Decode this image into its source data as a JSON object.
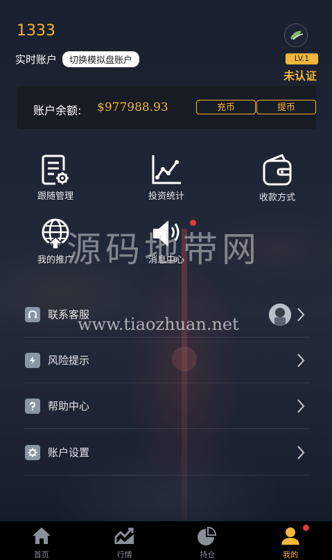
{
  "header": {
    "uid": "1333",
    "account_type": "实时账户",
    "switch_label": "切换模拟盘账户",
    "level": "LV.1",
    "verify_status": "未认证"
  },
  "balance": {
    "label": "账户余额:",
    "value": "$977988.93",
    "charge_label": "充币",
    "withdraw_label": "提币"
  },
  "grid": [
    {
      "label": "跟随管理",
      "icon": "document-gear-icon"
    },
    {
      "label": "投资统计",
      "icon": "line-chart-icon"
    },
    {
      "label": "收款方式",
      "icon": "wallet-icon"
    },
    {
      "label": "我的推广",
      "icon": "globe-share-icon"
    },
    {
      "label": "消息中心",
      "icon": "speaker-icon"
    }
  ],
  "menu": [
    {
      "label": "联系客服",
      "icon": "headset-icon"
    },
    {
      "label": "风险提示",
      "icon": "lightning-icon"
    },
    {
      "label": "帮助中心",
      "icon": "question-icon"
    },
    {
      "label": "账户设置",
      "icon": "gear-icon"
    }
  ],
  "watermark": {
    "text": "源码地带网",
    "url": "www.tiaozhuan.net"
  },
  "tabbar": [
    {
      "label": "首页",
      "icon": "home-icon"
    },
    {
      "label": "行情",
      "icon": "market-chart-icon"
    },
    {
      "label": "持仓",
      "icon": "pie-chart-icon"
    },
    {
      "label": "我的",
      "icon": "user-icon",
      "active": true
    }
  ],
  "colors": {
    "accent": "#f4b63a",
    "badge_red": "#e53935",
    "tab_bg": "#000000"
  }
}
